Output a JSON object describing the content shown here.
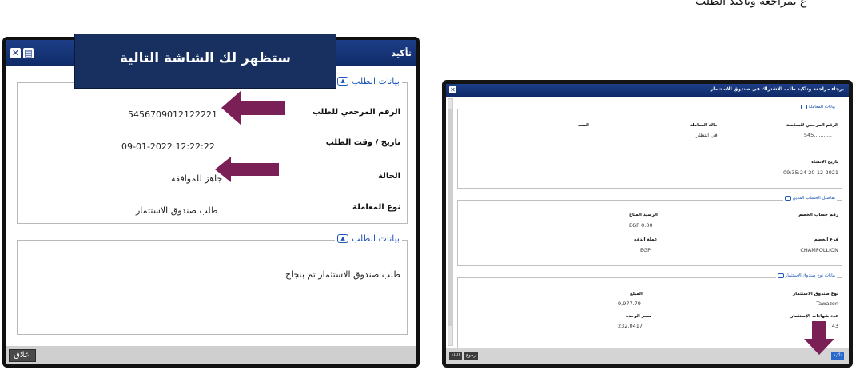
{
  "top_caption": "ع بمراجعة وتأكيد الطلب",
  "left_window": {
    "title": "تأكيد",
    "callout": "ستظهر لك الشاشة التالية",
    "section1": {
      "legend": "بيانات الطلب",
      "rows": [
        {
          "label": "الرقم المرجعي للطلب",
          "value": "5456709012122221"
        },
        {
          "label": "تاريخ / وقت الطلب",
          "value": "12:22:22 09-01-2022"
        },
        {
          "label": "الحالة",
          "value": "جاهز للموافقة"
        },
        {
          "label": "نوع المعاملة",
          "value": "طلب صندوق الاستثمار"
        }
      ]
    },
    "section2": {
      "legend": "بيانات الطلب",
      "message": "طلب صندوق الاستثمار تم بنجاح"
    },
    "close_label": "اغلاق",
    "accent_color": "#7b1f57"
  },
  "right_window": {
    "title": "برجاء مراجعة وتأكيد طلب الاشتراك في صندوق الاستثمار",
    "tx": {
      "legend": "بيانات المعاملة",
      "ref_label": "الرقم المرجعي للمعاملة",
      "ref_value": "545...........",
      "status_label": "حالة المعاملة",
      "status_value": "في انتظار",
      "rate_label": "المعد",
      "created_label": "تاريخ الإنشاء",
      "created_value": "09:35:24 20-12-2021"
    },
    "account": {
      "legend": "تفاصيل الحساب المدين",
      "acct_label": "رقم حساب الخصم",
      "balance_label": "الرصيد المتاح",
      "balance_value": "EGP 0.00",
      "branch_label": "فرع الخصم",
      "branch_value": "CHAMPOLLION",
      "currency_label": "عملة الدفع",
      "currency_value": "EGP"
    },
    "fund": {
      "legend": "بيانات نوع صندوق الاستثمار",
      "type_label": "نوع صندوق الاستثمار",
      "type_value": "Tawazon",
      "amount_label": "المبلغ",
      "amount_value": "9,977.79",
      "certs_label": "عدد شهادات الإستثمار",
      "certs_value": "43",
      "price_label": "سعر الوحدة",
      "price_value": "232.0417"
    },
    "buttons": {
      "confirm": "تأكيد",
      "back": "رجوع",
      "cancel": "الغاء"
    }
  }
}
